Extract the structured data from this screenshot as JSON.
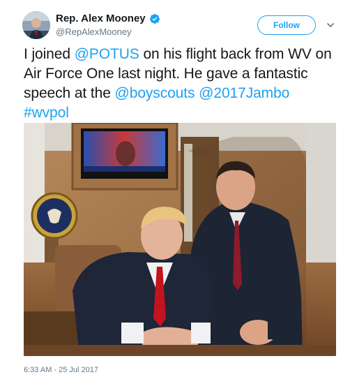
{
  "author": {
    "display_name": "Rep. Alex Mooney",
    "handle": "@RepAlexMooney",
    "verified": true,
    "avatar_icon": "profile-photo"
  },
  "actions": {
    "follow_label": "Follow",
    "menu_icon": "chevron-down-icon"
  },
  "tweet": {
    "parts": [
      {
        "text": "I joined ",
        "link": false
      },
      {
        "text": "@POTUS",
        "link": true
      },
      {
        "text": " on his flight back from WV on Air Force One last night. He gave a fantastic speech at the ",
        "link": false
      },
      {
        "text": "@boyscouts",
        "link": true
      },
      {
        "text": " ",
        "link": false
      },
      {
        "text": "@2017Jambo",
        "link": true
      },
      {
        "text": " ",
        "link": false
      },
      {
        "text": "#wvpol",
        "link": true
      }
    ],
    "timestamp": "6:33 AM - 25 Jul 2017"
  },
  "colors": {
    "link": "#1da1f2",
    "verified": "#1da1f2",
    "secondary_text": "#657786"
  }
}
